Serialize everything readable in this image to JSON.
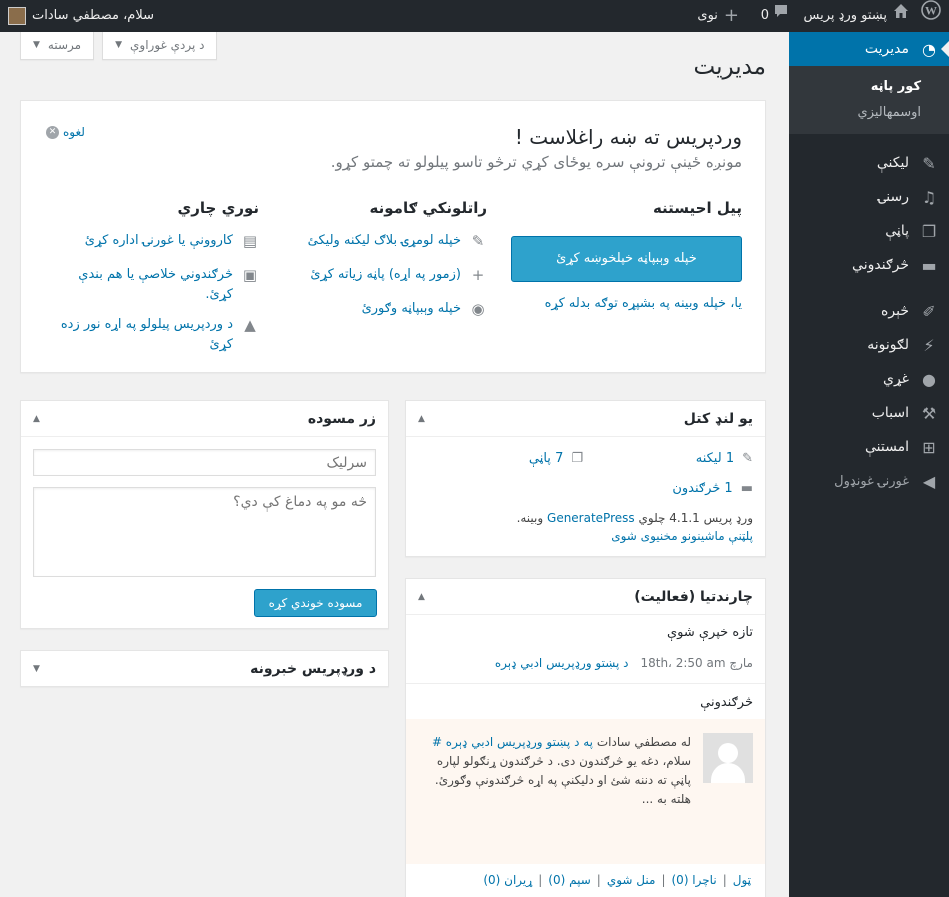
{
  "adminbar": {
    "site_name": "پښتو ورډ پریس",
    "comments_count": "0",
    "new_label": "نوی",
    "account_greeting": "سلام، مصطفي سادات"
  },
  "sidebar": {
    "dashboard": "مديريت",
    "submenu": [
      "کور پاڼه",
      "اوسمهالیزي"
    ],
    "items": [
      "ليکنې",
      "رسنۍ",
      "پاڼې",
      "څرګندوني",
      "څېره",
      "لګونونه",
      "غړي",
      "اسباب",
      "امستنې"
    ],
    "collapse": "غورنۍ غونډول"
  },
  "screen_tabs": {
    "screen_options": "د پردې غوراوې",
    "help": "مرسته"
  },
  "page_title": "مديريت",
  "welcome": {
    "title": "وردپریس ته ښه راغلاست !",
    "about": "مونږه ځینې ترونې سره یوځای کړي ترڅو تاسو پیلولو ته چمتو کړو.",
    "dismiss": "لغوه",
    "col1_heading": "پیل احیستنه",
    "button": "خپله وېبپاڼه خپلخوښه کړئ",
    "alt_link": "یا، خپله وبینه په بشپړه توګه بدله کړه",
    "col2_heading": "راتلونکي ګامونه",
    "col2_items": [
      "خپله لومړۍ بلاګ لیکنه ولیکئ",
      "(زمور په اړه) پاڼه زیاته کړئ",
      "خپله وېبپاڼه وګورئ"
    ],
    "col3_heading": "نوري چاري",
    "col3_items": [
      "کاروونې یا غورنۍ اداره کړئ",
      "څرګندوني خلاصې یا هم بندې کړئ.",
      "د وردپریس پیلولو په اړه نور زده کړئ"
    ]
  },
  "glance": {
    "title": "یو لنډ کتل",
    "posts": "1 لیکنه",
    "pages": "7 پاڼې",
    "comments": "1 څرګندون",
    "version_text": "ورډ پریس 4.1.1 چلوي ",
    "theme": "GeneratePress",
    "version_tail": " وبینه.",
    "privacy": "پلټنې ماشینونو مخنیوی شوی"
  },
  "quickdraft": {
    "title": "زر مسوده",
    "title_placeholder": "سرلیک",
    "content_placeholder": "څه مو په دماغ کې دي؟",
    "button": "مسوده خوندي کړه"
  },
  "news": {
    "title": "د ورډپریس خبرونه"
  },
  "activity": {
    "title": "چارندتیا (فعالیت)",
    "recent_heading": "تازه خپرې شوې",
    "date": "مارچ 18th، 2:50 am",
    "post_link": "د پښتو ورډپریس ادبي ډېره",
    "comments_heading": "څرګندونې",
    "comment_author": "له مصطفي سادات",
    "comment_on": "په د پښتو ورډپریس ادبي ډېره #",
    "comment_body": "سلام، دغه یو څرګندون دی. د څرګندون ړنګولو لپاره پاڼې ته دننه شئ او دلیکنې په اړه څرګندونې وګورئ. هلته به ...",
    "filters": [
      "ټول",
      "ناچرا (0)",
      "منل شوي",
      "سپم (0)",
      "ړیران (0)"
    ]
  }
}
